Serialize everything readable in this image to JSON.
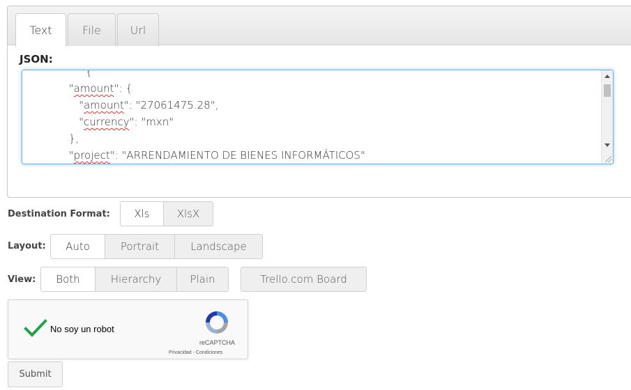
{
  "tabs": [
    {
      "label": "Text",
      "active": true
    },
    {
      "label": "File",
      "active": false
    },
    {
      "label": "Url",
      "active": false
    }
  ],
  "json_label": "JSON:",
  "editor_lines": [
    {
      "indent": "                ",
      "key": "",
      "rest": "   {"
    },
    {
      "indent": "              ",
      "key": "amount",
      "rest": ": {"
    },
    {
      "indent": "                 ",
      "key": "amount",
      "rest": ": \"27061475.28\","
    },
    {
      "indent": "                 ",
      "key": "currency",
      "rest": ": \"mxn\""
    },
    {
      "indent": "              ",
      "key": "",
      "rest": "},"
    },
    {
      "indent": "              ",
      "key": "project",
      "rest": ": \"ARRENDAMIENTO DE BIENES INFORMÁTICOS\""
    },
    {
      "indent": "          ",
      "key": "",
      "rest": "}"
    }
  ],
  "destination": {
    "label": "Destination Format:",
    "options": [
      "Xls",
      "XlsX"
    ],
    "selected": "Xls"
  },
  "layout": {
    "label": "Layout:",
    "options": [
      "Auto",
      "Portrait",
      "Landscape"
    ],
    "selected": "Auto"
  },
  "view": {
    "label": "View:",
    "options": [
      "Both",
      "Hierarchy",
      "Plain"
    ],
    "selected": "Both",
    "trello_label": "Trello.com Board"
  },
  "captcha": {
    "label": "No soy un robot",
    "brand": "reCAPTCHA",
    "links": "Privacidad - Condiciones"
  },
  "submit_label": "Submit"
}
